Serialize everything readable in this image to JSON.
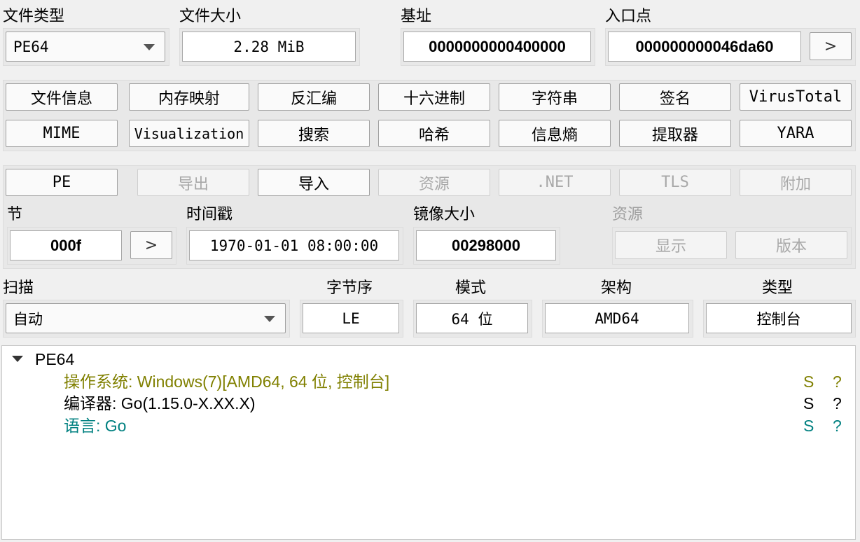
{
  "header": {
    "file_type_label": "文件类型",
    "file_type_value": "PE64",
    "file_size_label": "文件大小",
    "file_size_value": "2.28 MiB",
    "base_label": "基址",
    "base_value": "0000000000400000",
    "entry_label": "入口点",
    "entry_value": "000000000046da60",
    "entry_go": ">"
  },
  "tools": {
    "row1": [
      "文件信息",
      "内存映射",
      "反汇编",
      "十六进制",
      "字符串",
      "签名",
      "VirusTotal"
    ],
    "row2": [
      "MIME",
      "Visualization",
      "搜索",
      "哈希",
      "信息熵",
      "提取器",
      "YARA"
    ]
  },
  "pe_tabs": [
    "PE",
    "导出",
    "导入",
    "资源",
    ".NET",
    "TLS",
    "附加"
  ],
  "pe_info": {
    "section_label": "节",
    "section_value": "000f",
    "section_go": ">",
    "timestamp_label": "时间戳",
    "timestamp_value": "1970-01-01 08:00:00",
    "image_size_label": "镜像大小",
    "image_size_value": "00298000",
    "resources_label": "资源",
    "show_label": "显示",
    "version_label": "版本"
  },
  "scan": {
    "scan_label": "扫描",
    "scan_value": "自动",
    "endian_label": "字节序",
    "endian_value": "LE",
    "mode_label": "模式",
    "mode_value": "64 位",
    "arch_label": "架构",
    "arch_value": "AMD64",
    "type_label": "类型",
    "type_value": "控制台"
  },
  "results": {
    "root": "PE64",
    "items": [
      {
        "text": "操作系统: Windows(7)[AMD64, 64 位, 控制台]",
        "s": "S",
        "q": "?",
        "color": "#808000"
      },
      {
        "text": "编译器: Go(1.15.0-X.XX.X)",
        "s": "S",
        "q": "?",
        "color": "#000000"
      },
      {
        "text": "语言: Go",
        "s": "S",
        "q": "?",
        "color": "#008080"
      }
    ]
  }
}
